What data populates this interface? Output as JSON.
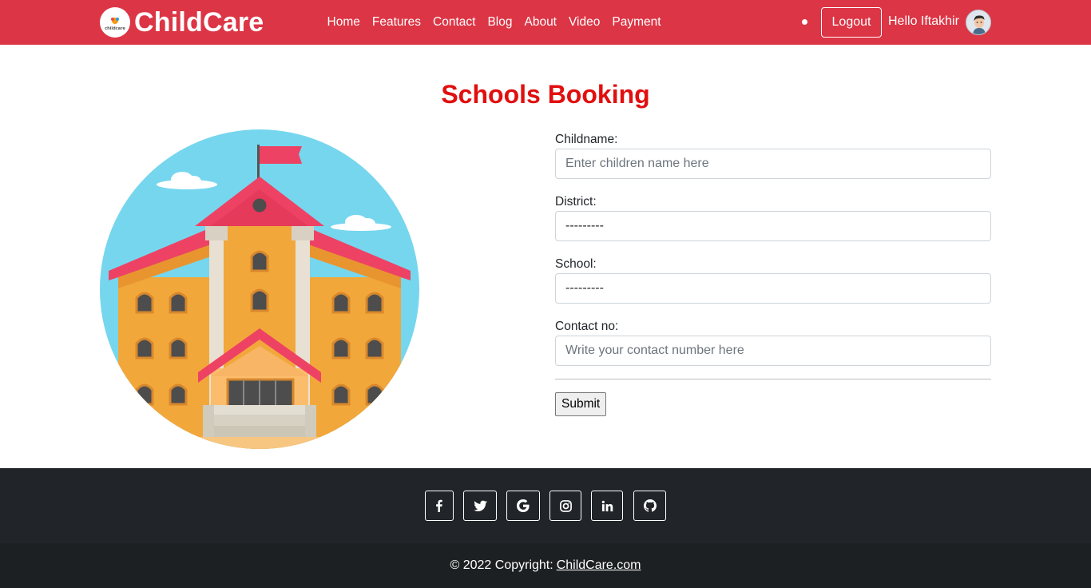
{
  "navbar": {
    "brand": "ChildCare",
    "brand_logo_text": "childcare",
    "links": [
      "Home",
      "Features",
      "Contact",
      "Blog",
      "About",
      "Video",
      "Payment"
    ],
    "logout_label": "Logout",
    "greeting": "Hello Iftakhir"
  },
  "main": {
    "title": "Schools Booking",
    "form": {
      "childname_label": "Childname:",
      "childname_placeholder": "Enter children name here",
      "district_label": "District:",
      "district_value": "---------",
      "school_label": "School:",
      "school_value": "---------",
      "contact_label": "Contact no:",
      "contact_placeholder": "Write your contact number here",
      "submit_label": "Submit"
    }
  },
  "footer": {
    "social_icons": [
      "facebook-icon",
      "twitter-icon",
      "google-icon",
      "instagram-icon",
      "linkedin-icon",
      "github-icon"
    ],
    "copyright_text": "© 2022 Copyright:",
    "copyright_link": "ChildCare.com"
  },
  "colors": {
    "navbar": "#dc3545",
    "title": "#e10f0f",
    "footer_top": "#212529",
    "footer_bottom": "#1d2022"
  }
}
